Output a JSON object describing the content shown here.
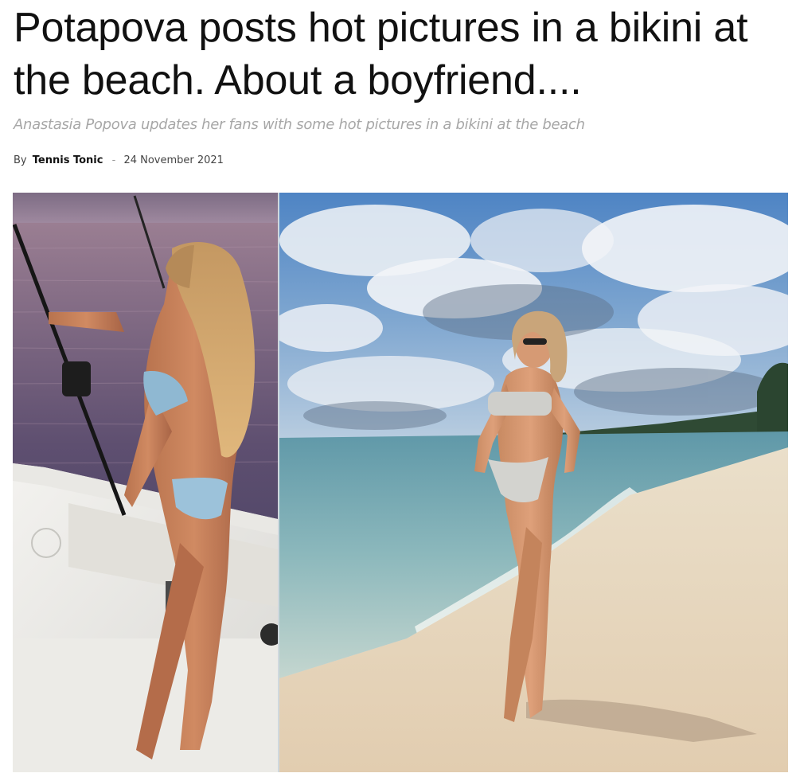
{
  "article": {
    "headline": "Potapova posts hot pictures in a bikini at the beach. About a boyfriend....",
    "subtitle": "Anastasia Popova updates her fans with some hot pictures in a bikini at the beach",
    "byline": {
      "by_label": "By",
      "author": "Tennis Tonic",
      "separator": "-",
      "date": "24 November 2021"
    }
  },
  "colors": {
    "headline": "#111111",
    "subtitle": "#a7a7a7",
    "byline_text": "#444444",
    "sea_dusk": "#6b5a72",
    "sky_blue": "#4d86c8",
    "sand": "#e8d6b8"
  }
}
